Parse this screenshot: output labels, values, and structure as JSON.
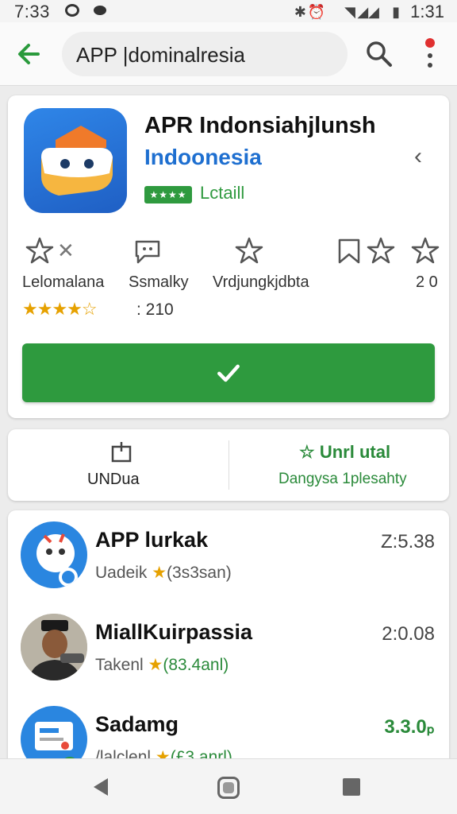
{
  "status_bar": {
    "time_left": "7:33",
    "time_right": "1:31"
  },
  "search": {
    "query": "APP |dominalresia"
  },
  "app": {
    "title": "APR Indonsiahjlunsh",
    "subtitle": "Indoonesia",
    "badge_text": "★★★★",
    "badge_label": "Lctaill",
    "meta": [
      {
        "icon": "star-outline-icon",
        "label": "Lelomalana"
      },
      {
        "icon": "chat-bubble-icon",
        "label": "Ssmalky"
      },
      {
        "icon": "star-outline-icon",
        "label": "Vrdjungkjdbta"
      },
      {
        "icon": "bookmark-icon",
        "label": ""
      },
      {
        "icon": "star-outline-icon",
        "label": "2 0"
      }
    ],
    "stars": "★★★★☆",
    "rating_count": ": 210",
    "install_icon": "checkmark-icon"
  },
  "actions": {
    "left_label": "UNDua",
    "right_title": "Unrl utal",
    "right_sub": "Dangysa 1plesahty"
  },
  "related": [
    {
      "title": "APP lurkak",
      "sub_left": "Uadeik",
      "sub_right": "(3s3san)",
      "price": "Z:5.38",
      "green": false
    },
    {
      "title": "MiallKuirpassia",
      "sub_left": "Takenl",
      "sub_right": "(83.4anl)",
      "price": "2:0.08",
      "green": false
    },
    {
      "title": "Sadamg",
      "sub_left": "/lalclenl",
      "sub_right": "(£3.anrl)",
      "price": "3.3.0ₚ",
      "green": true
    }
  ]
}
